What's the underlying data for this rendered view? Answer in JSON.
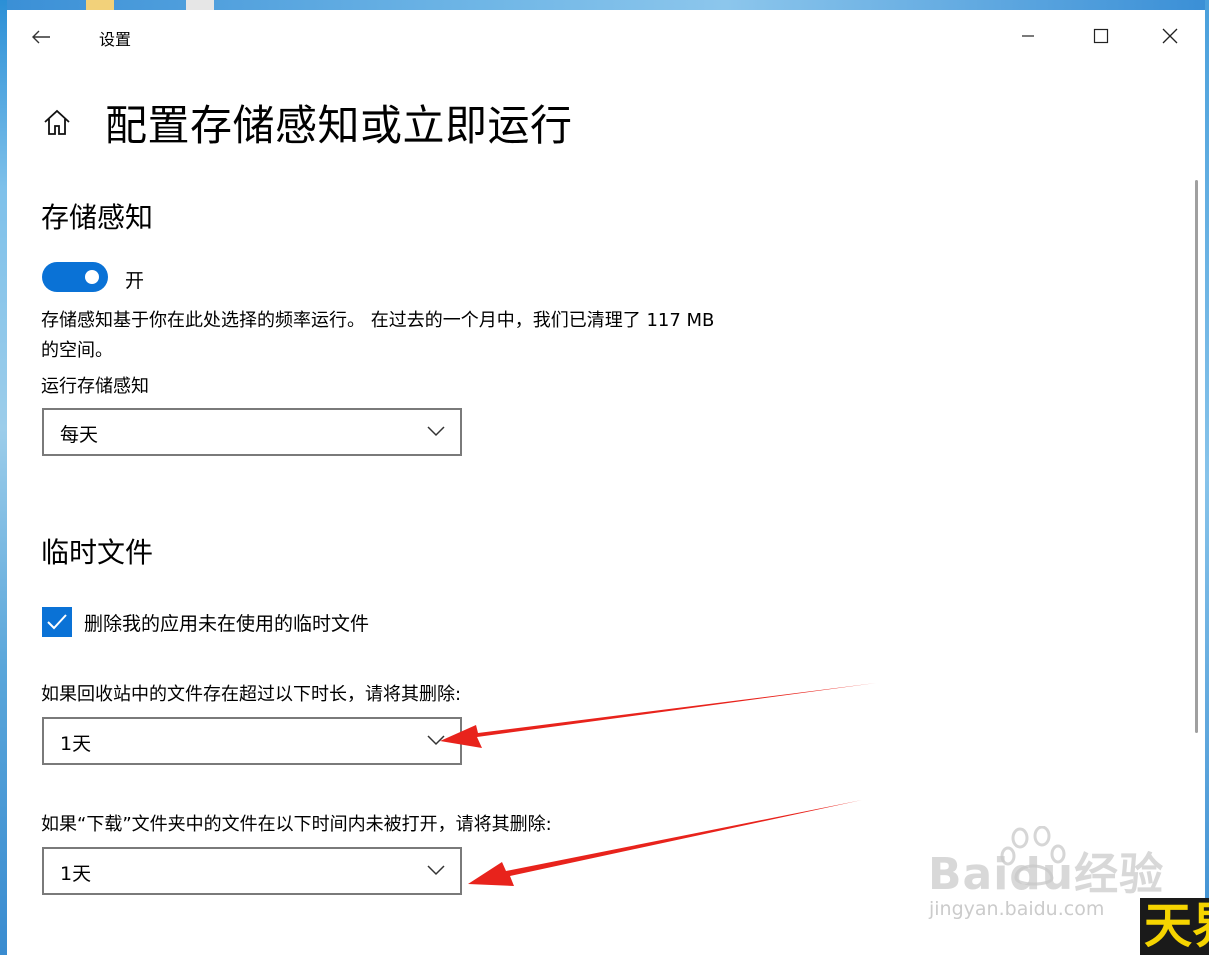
{
  "window": {
    "app_title": "设置"
  },
  "page": {
    "title": "配置存储感知或立即运行"
  },
  "storage_sense": {
    "heading": "存储感知",
    "toggle_label": "开",
    "toggle_on": true,
    "description": "存储感知基于你在此处选择的频率运行。 在过去的一个月中，我们已清理了 117 MB 的空间。",
    "run_label": "运行存储感知",
    "run_value": "每天"
  },
  "temp_files": {
    "heading": "临时文件",
    "delete_temp_label": "删除我的应用未在使用的临时文件",
    "delete_temp_checked": true,
    "recycle_label": "如果回收站中的文件存在超过以下时长，请将其删除:",
    "recycle_value": "1天",
    "downloads_label": "如果“下载”文件夹中的文件在以下时间内未被打开，请将其删除:",
    "downloads_value": "1天"
  },
  "watermark": {
    "brand": "Baidu经验",
    "site": "jingyan.baidu.com",
    "corner_text": "天界"
  },
  "colors": {
    "accent": "#0a72d6",
    "annotation_arrow": "#e8231c"
  },
  "icons": [
    "back-arrow-icon",
    "minimize-icon",
    "maximize-icon",
    "close-icon",
    "home-icon",
    "chevron-down-icon",
    "checkmark-icon"
  ]
}
